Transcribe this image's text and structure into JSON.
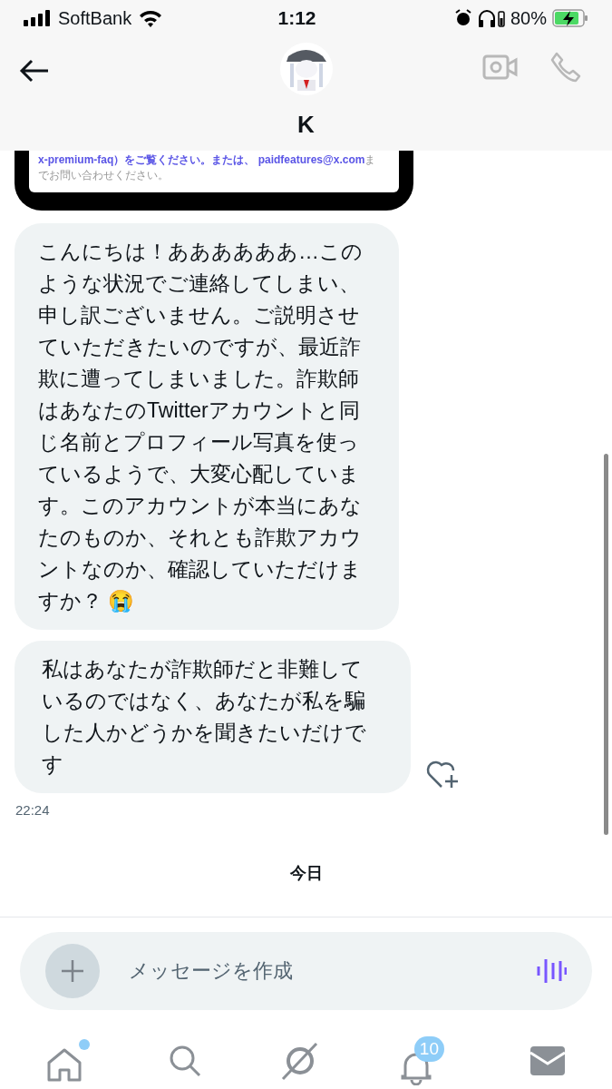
{
  "status_bar": {
    "carrier": "SoftBank",
    "time": "1:12",
    "battery": "80%"
  },
  "header": {
    "name": "K"
  },
  "shared_image": {
    "line_1_link": "x-premium-faq）をご覧ください。または、 paidfeatures@x.com",
    "line_1_tail": "ま",
    "line_2": "でお問い合わせください。"
  },
  "messages": [
    {
      "text": "こんにちは！ああああああ…このような状況でご連絡してしまい、申し訳ございません。ご説明させていただきたいのですが、最近詐欺に遭ってしまいました。詐欺師はあなたのTwitterアカウントと同じ名前とプロフィール写真を使っているようで、大変心配しています。このアカウントが本当にあなたのものか、それとも詐欺アカウントなのか、確認していただけますか？ 😭"
    },
    {
      "text": "私はあなたが詐欺師だと非難しているのではなく、あなたが私を騙した人かどうかを聞きたいだけです"
    }
  ],
  "timestamp": "22:24",
  "day_divider": "今日",
  "composer": {
    "placeholder": "メッセージを作成"
  },
  "nav": {
    "home_unread": true,
    "notifications_count": "10"
  }
}
